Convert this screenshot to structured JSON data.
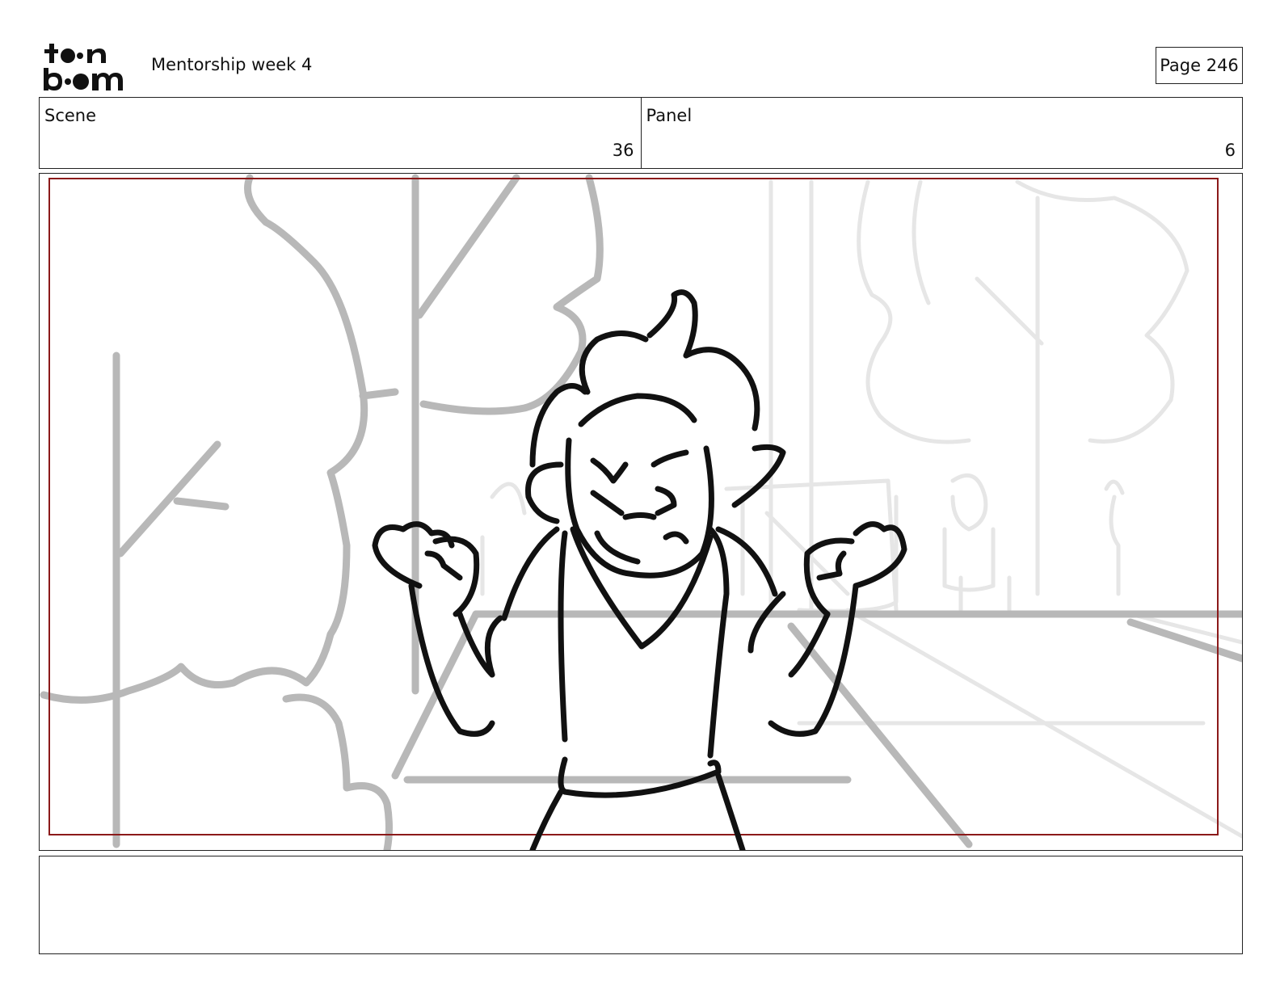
{
  "header": {
    "logo_text": "toon boom",
    "title": "Mentorship week 4",
    "page_label": "Page 246"
  },
  "info": {
    "scene_label": "Scene",
    "scene_value": "36",
    "panel_label": "Panel",
    "panel_value": "6"
  },
  "panel": {
    "image_icon": "storyboard-sketch",
    "frame_color": "#8b1a1a"
  },
  "notes": {
    "text": ""
  }
}
